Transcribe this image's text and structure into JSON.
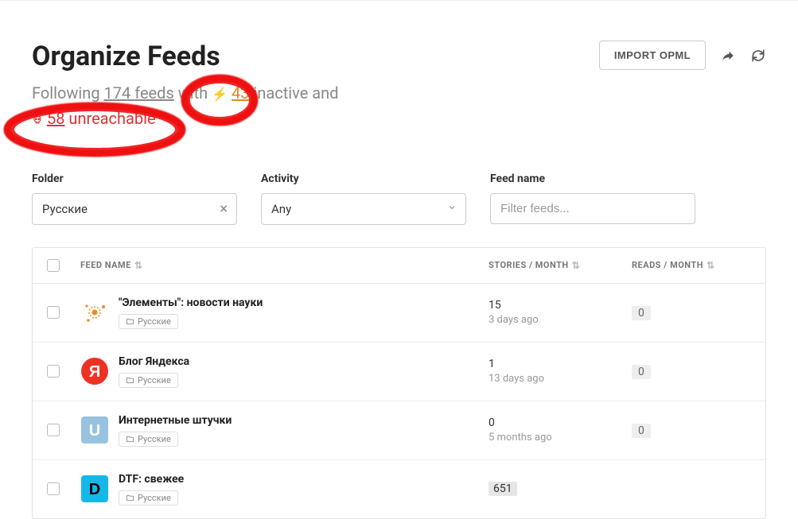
{
  "header": {
    "title": "Organize Feeds",
    "import_label": "IMPORT OPML"
  },
  "subtitle": {
    "prefix": "Following ",
    "feeds_count": "174",
    "feeds_word": "feeds",
    "with_text": " with ",
    "inactive_count": "43",
    "inactive_word": " inactive and",
    "unreachable_count": "58",
    "unreachable_word": " unreachable"
  },
  "filters": {
    "folder": {
      "label": "Folder",
      "value": "Русские"
    },
    "activity": {
      "label": "Activity",
      "value": "Any"
    },
    "feedname": {
      "label": "Feed name",
      "placeholder": "Filter feeds..."
    }
  },
  "table": {
    "headers": {
      "name": "FEED NAME",
      "stories": "STORIES / MONTH",
      "reads": "READS / MONTH"
    }
  },
  "feeds": [
    {
      "title": "\"Элементы\": новости науки",
      "folder": "Русские",
      "stories": "15",
      "ago": "3 days ago",
      "reads": "0",
      "icon": "elementy"
    },
    {
      "title": "Блог Яндекса",
      "folder": "Русские",
      "stories": "1",
      "ago": "13 days ago",
      "reads": "0",
      "icon": "yandex"
    },
    {
      "title": "Интернетные штучки",
      "folder": "Русские",
      "stories": "0",
      "ago": "5 months ago",
      "reads": "0",
      "icon": "internet"
    },
    {
      "title": "DTF: свежее",
      "folder": "Русские",
      "stories": "651",
      "ago": "",
      "reads": "",
      "icon": "dtf",
      "highlight": true
    }
  ],
  "icons": {
    "elementy": {
      "bg": "#ffffff",
      "fg": "#f08a24",
      "letter": ""
    },
    "yandex": {
      "bg": "#ef3124",
      "fg": "#ffffff",
      "letter": "Я"
    },
    "internet": {
      "bg": "#98c3e0",
      "fg": "#ffffff",
      "letter": "U"
    },
    "dtf": {
      "bg": "#16b7e8",
      "fg": "#000000",
      "letter": "D"
    }
  }
}
